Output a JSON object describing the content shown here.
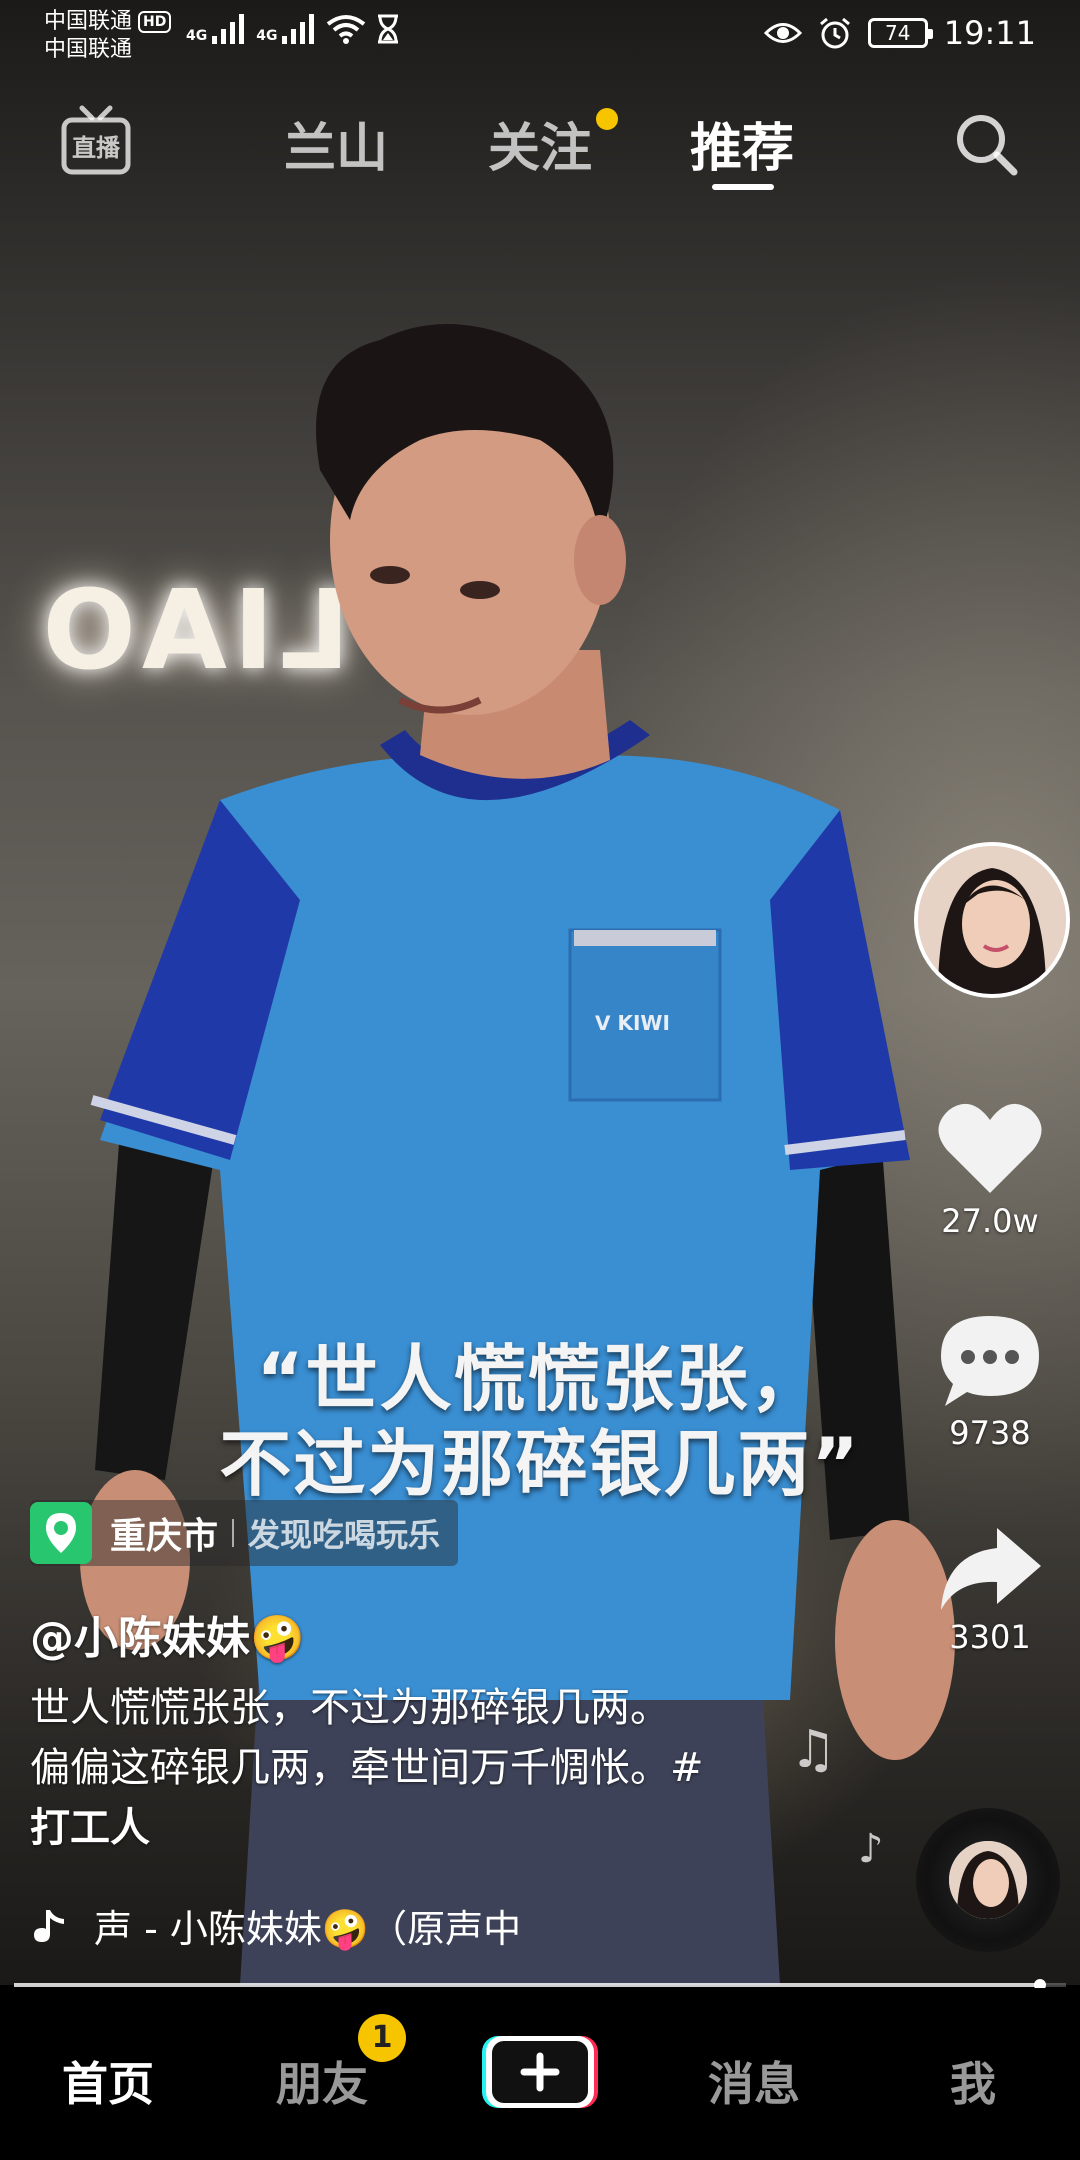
{
  "status_bar": {
    "carrier_1": "中国联通",
    "carrier_2": "中国联通",
    "hd": "HD",
    "net_1": "4G",
    "net_2": "4G",
    "battery": "74",
    "time": "19:11"
  },
  "top_nav": {
    "live_label": "直播",
    "tabs": [
      {
        "label": "兰山",
        "active": false
      },
      {
        "label": "关注",
        "active": false,
        "has_dot": true
      },
      {
        "label": "推荐",
        "active": true
      }
    ]
  },
  "video": {
    "caption_line_1": "“世人慌慌张张，",
    "caption_line_2": "不过为那碎银几两”"
  },
  "rail": {
    "likes": "27.0w",
    "comments": "9738",
    "shares": "3301"
  },
  "post": {
    "location_city": "重庆市",
    "location_sub": "发现吃喝玩乐",
    "author": "@小陈妹妹🤪",
    "desc_line_1": "世人慌慌张张，不过为那碎银几两。",
    "desc_line_2": "偏偏这碎银几两，牵世间万千惆怅。#",
    "hashtag": "打工人",
    "music": "声 - 小陈妹妹🤪（原声中",
    "progress_fraction": 0.975
  },
  "tabbar": {
    "home": "首页",
    "friends": "朋友",
    "friends_badge": "1",
    "messages": "消息",
    "me": "我"
  },
  "colors": {
    "location_green": "#28c76f",
    "badge_yellow": "#f6c500",
    "add_cyan": "#25f4ee",
    "add_red": "#fe2c55"
  }
}
